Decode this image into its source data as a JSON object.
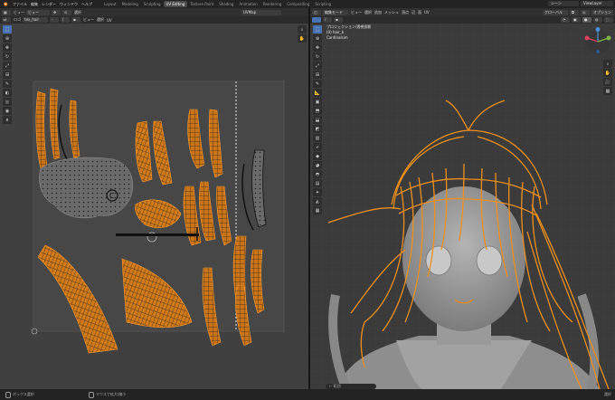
{
  "topbar": {
    "menus": [
      "ファイル",
      "編集",
      "レンダー",
      "ウィンドウ",
      "ヘルプ"
    ],
    "workspaces": [
      "Layout",
      "Modeling",
      "Sculpting",
      "UV Editing",
      "Texture Paint",
      "Shading",
      "Animation",
      "Rendering",
      "Compositing",
      "Scripting"
    ],
    "active_workspace": "UV Editing",
    "scene_label": "シーン",
    "view_layer_label": "ViewLayer"
  },
  "uv_header": {
    "view_label": "ビュー",
    "image_label": "画像",
    "mode_label": "ビュー",
    "select_label": "選択",
    "uv_menu": "UV",
    "image_name": "UVMap"
  },
  "uv_subheader": {
    "sync_label": "ロゴ",
    "pivot_label": "テクスチャ",
    "image_field": "tex_hair",
    "view_menu": "ビュー",
    "select_menu": "選択",
    "uv_menu": "UV"
  },
  "viewport_header": {
    "mode": "編集モード",
    "view": "ビュー",
    "select": "選択",
    "add": "追加",
    "mesh": "メッシュ",
    "vertex": "頂点",
    "edge": "辺",
    "face": "面",
    "uv": "UV",
    "transform": "グローバル",
    "options": "オプション"
  },
  "viewport_overlay": {
    "line1": "プロジェクション/透視投影",
    "line2": "(0) hair_b",
    "line3": "Cardinalsim"
  },
  "status": {
    "select_label": "ボックス選択",
    "menu_label": "マウスで拡大/縮小",
    "right_info": "選択",
    "search_placeholder": "← 範囲"
  },
  "colors": {
    "accent": "#4772b3",
    "uv_island": "#e08a1f",
    "hair_wire": "#f0901c"
  }
}
